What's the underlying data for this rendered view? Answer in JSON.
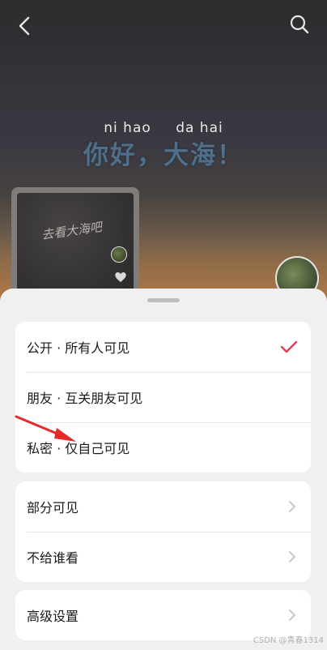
{
  "video": {
    "pinyin": [
      "ni hao",
      "da hai"
    ],
    "headline": "你好，大海！",
    "thumbnail_caption": "去看大海吧"
  },
  "visibility_sheet": {
    "groups": [
      {
        "items": [
          {
            "label": "公开 · 所有人可见",
            "selected": true
          },
          {
            "label": "朋友 · 互关朋友可见",
            "selected": false
          },
          {
            "label": "私密 · 仅自己可见",
            "selected": false
          }
        ]
      },
      {
        "items": [
          {
            "label": "部分可见"
          },
          {
            "label": "不给谁看"
          }
        ]
      },
      {
        "items": [
          {
            "label": "高级设置"
          }
        ]
      }
    ]
  },
  "watermark": "CSDN @青春1314",
  "colors": {
    "check": "#e8385a",
    "arrow": "#e52a2a",
    "chevron": "#c8c8c8"
  },
  "icons": {
    "back": "back-arrow-icon",
    "search": "search-icon",
    "check": "checkmark-icon",
    "chevron": "chevron-right-icon",
    "heart": "heart-icon"
  }
}
